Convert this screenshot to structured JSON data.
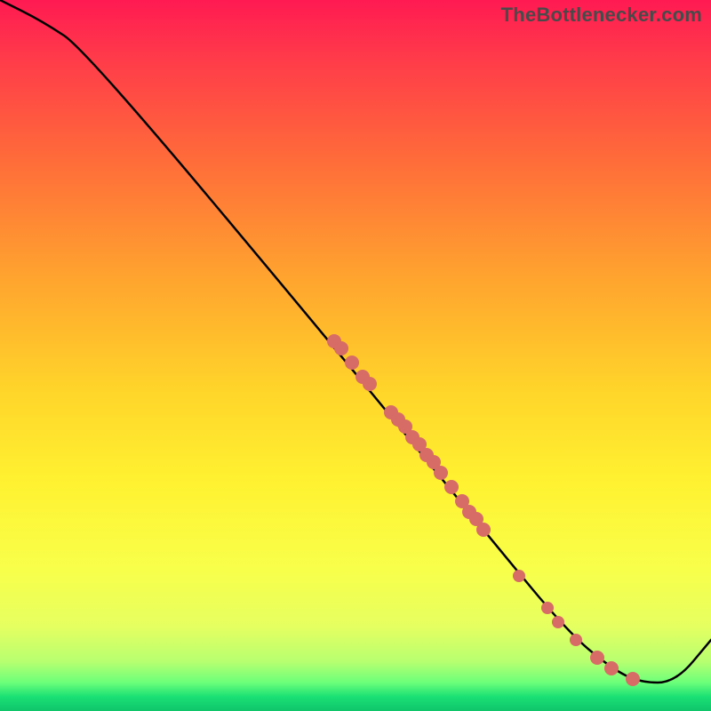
{
  "attribution": "TheBottlenecker.com",
  "chart_data": {
    "type": "line",
    "title": "",
    "xlabel": "",
    "ylabel": "",
    "xlim": [
      0,
      100
    ],
    "ylim": [
      0,
      100
    ],
    "curve": {
      "x": [
        0,
        6,
        12,
        48,
        70,
        80,
        86,
        90,
        95,
        100
      ],
      "y": [
        100,
        97,
        93,
        50,
        23,
        11,
        6,
        4,
        4,
        10
      ]
    },
    "series": [
      {
        "name": "markers",
        "points": [
          {
            "x": 47,
            "y": 52,
            "r": 8
          },
          {
            "x": 48,
            "y": 51,
            "r": 8
          },
          {
            "x": 49.5,
            "y": 49,
            "r": 8
          },
          {
            "x": 51,
            "y": 47,
            "r": 8
          },
          {
            "x": 52,
            "y": 46,
            "r": 8
          },
          {
            "x": 55,
            "y": 42,
            "r": 8
          },
          {
            "x": 56,
            "y": 41,
            "r": 8
          },
          {
            "x": 57,
            "y": 40,
            "r": 8
          },
          {
            "x": 58,
            "y": 38.5,
            "r": 8
          },
          {
            "x": 59,
            "y": 37.5,
            "r": 8
          },
          {
            "x": 60,
            "y": 36,
            "r": 8
          },
          {
            "x": 61,
            "y": 35,
            "r": 8
          },
          {
            "x": 62,
            "y": 33.5,
            "r": 8
          },
          {
            "x": 63.5,
            "y": 31.5,
            "r": 8
          },
          {
            "x": 65,
            "y": 29.5,
            "r": 8
          },
          {
            "x": 66,
            "y": 28,
            "r": 8
          },
          {
            "x": 67,
            "y": 27,
            "r": 8
          },
          {
            "x": 68,
            "y": 25.5,
            "r": 8
          },
          {
            "x": 73,
            "y": 19,
            "r": 7
          },
          {
            "x": 77,
            "y": 14.5,
            "r": 7
          },
          {
            "x": 78.5,
            "y": 12.5,
            "r": 7
          },
          {
            "x": 81,
            "y": 10,
            "r": 7
          },
          {
            "x": 84,
            "y": 7.5,
            "r": 8
          },
          {
            "x": 86,
            "y": 6,
            "r": 8
          },
          {
            "x": 89,
            "y": 4.5,
            "r": 8
          }
        ]
      }
    ]
  }
}
